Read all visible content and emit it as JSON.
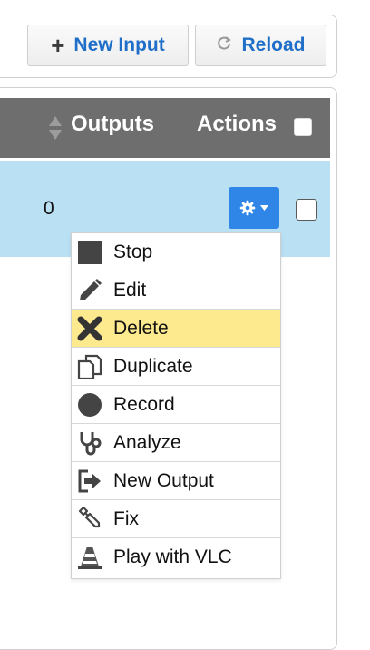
{
  "toolbar": {
    "new_input_label": "New Input",
    "reload_label": "Reload"
  },
  "table": {
    "columns": {
      "outputs": "Outputs",
      "actions": "Actions"
    },
    "rows": [
      {
        "outputs": "0",
        "selected": false,
        "highlighted": true
      }
    ]
  },
  "menu": {
    "items": [
      {
        "label": "Stop",
        "icon": "stop-icon"
      },
      {
        "label": "Edit",
        "icon": "pencil-icon"
      },
      {
        "label": "Delete",
        "icon": "x-icon",
        "hovered": true
      },
      {
        "label": "Duplicate",
        "icon": "duplicate-icon"
      },
      {
        "label": "Record",
        "icon": "record-icon"
      },
      {
        "label": "Analyze",
        "icon": "stethoscope-icon"
      },
      {
        "label": "New Output",
        "icon": "sign-out-icon"
      },
      {
        "label": "Fix",
        "icon": "wrench-icon"
      },
      {
        "label": "Play with VLC",
        "icon": "traffic-cone-icon"
      }
    ]
  },
  "colors": {
    "header_bg": "#6e6e6e",
    "row_selected_bg": "#b9e1f3",
    "button_blue": "#2f86e6",
    "link_blue": "#1f6fc9",
    "menu_hover": "#fde98e"
  }
}
